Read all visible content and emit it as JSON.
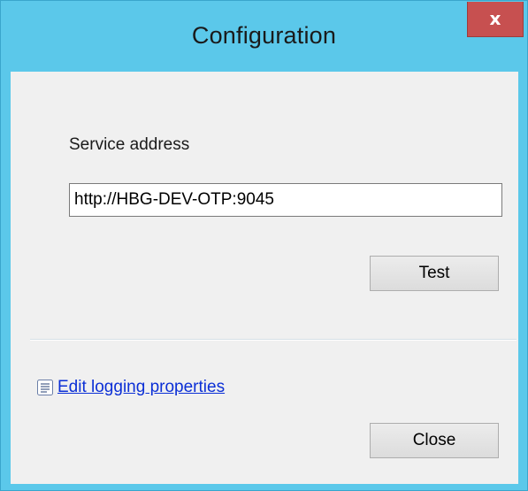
{
  "window": {
    "title": "Configuration",
    "close_glyph": "x",
    "colors": {
      "frame": "#5bc8ea",
      "client": "#f0f0f0",
      "close_button": "#c75050",
      "link": "#0b2fd6"
    }
  },
  "service": {
    "label": "Service address",
    "value": "http://HBG-DEV-OTP:9045"
  },
  "buttons": {
    "test_label": "Test",
    "close_label": "Close"
  },
  "logging": {
    "link_label": "Edit logging properties",
    "icon": "document-list-icon"
  }
}
